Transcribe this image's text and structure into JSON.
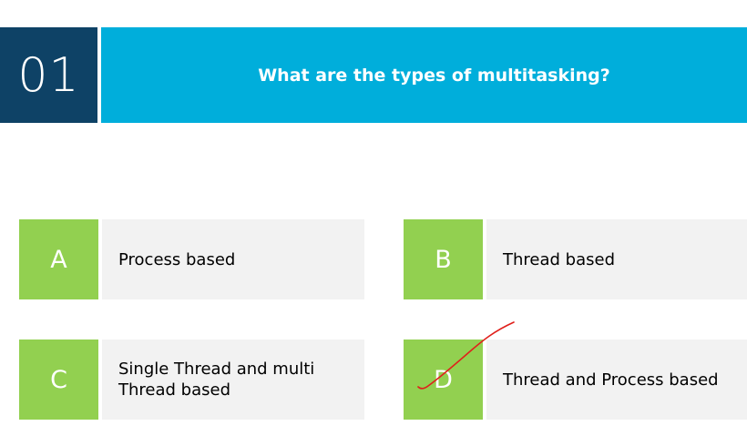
{
  "question": {
    "number": "01",
    "text": "What are the types of multitasking?"
  },
  "options": [
    {
      "letter": "A",
      "text": "Process based"
    },
    {
      "letter": "B",
      "text": "Thread based"
    },
    {
      "letter": "C",
      "text": "Single Thread and multi Thread based"
    },
    {
      "letter": "D",
      "text": "Thread and Process based"
    }
  ],
  "annotation": {
    "type": "handwritten-check-mark",
    "marked_option": "D",
    "color": "#e0201b"
  },
  "colors": {
    "number_box": "#0e4266",
    "title_box": "#00aedb",
    "option_letter_box": "#92d050",
    "option_body": "#f2f2f2"
  }
}
